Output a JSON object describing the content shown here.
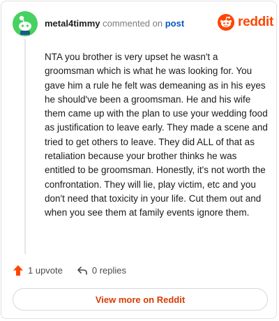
{
  "header": {
    "author": "metal4timmy",
    "action_text": "commented on",
    "post_link": "post",
    "brand_name": "reddit"
  },
  "comment": {
    "body": "NTA you brother is very upset he wasn't a groomsman which is what he was looking for. You gave him a rule he felt was demeaning as in his eyes he should've been a groomsman. He and his wife them came up with the plan to use your wedding food as justification to leave early. They made a scene and tried to get others to leave. They did ALL of that as retaliation because your brother thinks he was entitled to be groomsman. Honestly, it's not worth the confrontation. They will lie, play victim, etc and you don't need that toxicity in your life. Cut them out and when you see them at family events ignore them."
  },
  "actions": {
    "upvote_label": "1 upvote",
    "replies_label": "0 replies"
  },
  "footer": {
    "view_more_label": "View more on Reddit"
  },
  "colors": {
    "brand": "#ff4500",
    "link": "#0a56bf",
    "avatar_bg": "#46d160"
  },
  "icons": [
    "avatar-icon",
    "reddit-logo-icon",
    "upvote-arrow-icon",
    "reply-arrow-icon"
  ]
}
